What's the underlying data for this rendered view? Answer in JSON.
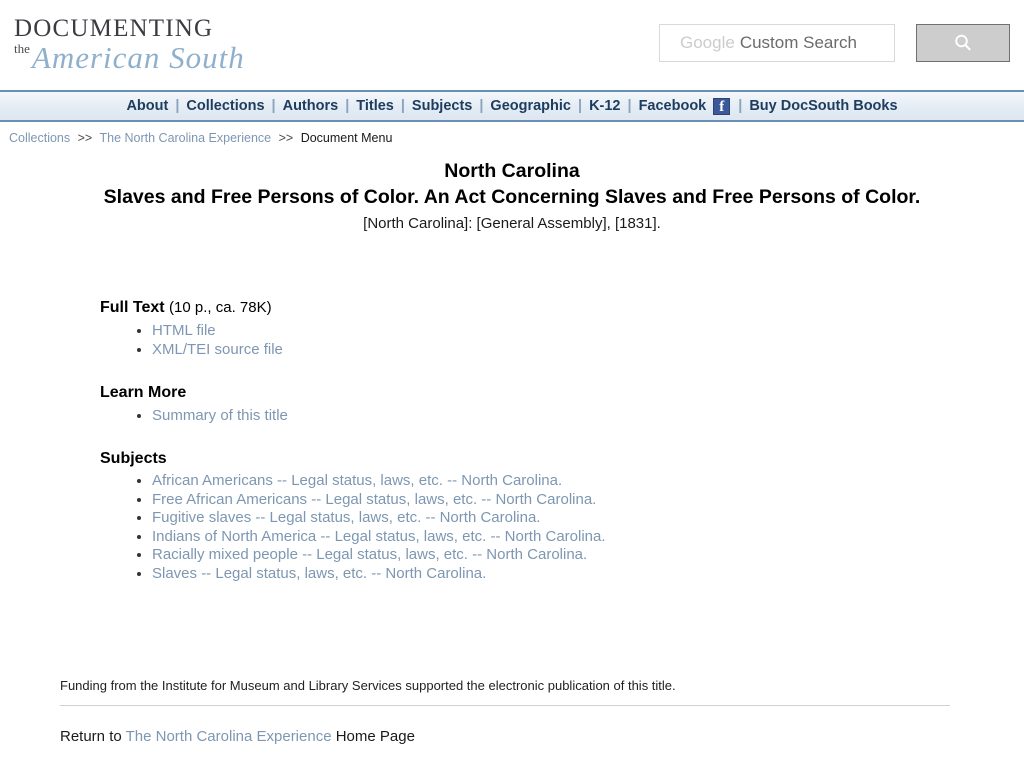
{
  "header": {
    "logo_line1": "DOCUMENTING",
    "logo_the": "the",
    "logo_script": "American South",
    "search": {
      "placeholder_brand": "Google",
      "placeholder_text": "Custom Search",
      "value": "",
      "button_icon": "search-icon"
    }
  },
  "nav": {
    "separator": "|",
    "items": [
      {
        "label": "About"
      },
      {
        "label": "Collections"
      },
      {
        "label": "Authors"
      },
      {
        "label": "Titles"
      },
      {
        "label": "Subjects"
      },
      {
        "label": "Geographic"
      },
      {
        "label": "K-12"
      },
      {
        "label": "Facebook"
      },
      {
        "label": "Buy DocSouth Books"
      }
    ],
    "facebook_icon_glyph": "f"
  },
  "breadcrumb": {
    "item1": "Collections",
    "sep1": ">>",
    "item2": "The North Carolina Experience",
    "sep2": ">>",
    "current": "Document Menu"
  },
  "title": {
    "line1": "North Carolina",
    "line2": "Slaves and Free Persons of Color. An Act Concerning Slaves and Free Persons of Color.",
    "imprint": "[North Carolina]: [General Assembly], [1831]."
  },
  "sections": {
    "full_text": {
      "heading": "Full Text",
      "detail": "(10 p., ca. 78K)",
      "links": [
        "HTML file",
        "XML/TEI source file"
      ]
    },
    "learn_more": {
      "heading": "Learn More",
      "links": [
        "Summary of this title"
      ]
    },
    "subjects": {
      "heading": "Subjects",
      "links": [
        "African Americans -- Legal status, laws, etc. -- North Carolina.",
        "Free African Americans -- Legal status, laws, etc. -- North Carolina.",
        "Fugitive slaves -- Legal status, laws, etc. -- North Carolina.",
        "Indians of North America -- Legal status, laws, etc. -- North Carolina.",
        "Racially mixed people -- Legal status, laws, etc. -- North Carolina.",
        "Slaves -- Legal status, laws, etc. -- North Carolina."
      ]
    }
  },
  "footer": {
    "funding": "Funding from the Institute for Museum and Library Services supported the electronic publication of this title.",
    "return_prefix": "Return to",
    "return_link": "The North Carolina Experience",
    "return_suffix": "Home Page"
  },
  "colors": {
    "link": "#7d97b2",
    "nav_text": "#1d3c5e",
    "nav_border": "#6a8fb3",
    "facebook_blue": "#3b5998",
    "script_blue": "#8fb0cc"
  }
}
